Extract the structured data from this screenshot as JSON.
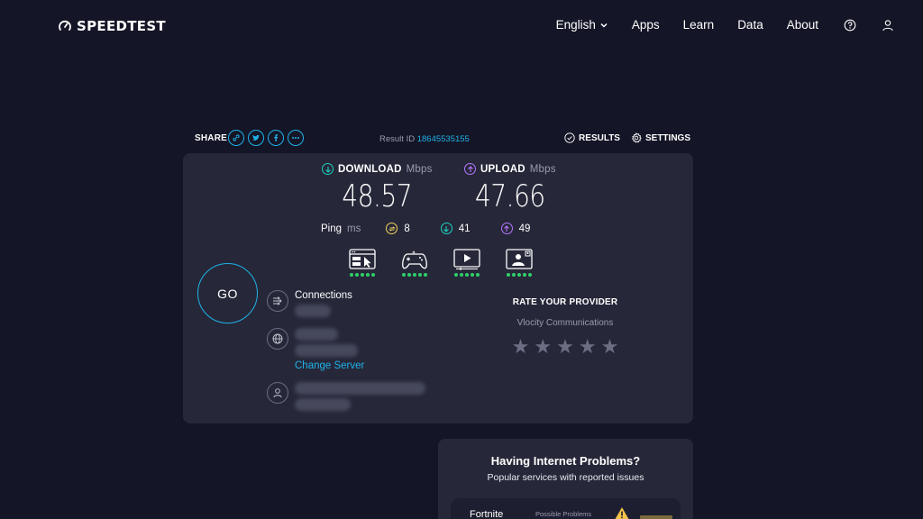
{
  "header": {
    "logo_text": "SPEEDTEST",
    "nav": {
      "language": "English",
      "apps": "Apps",
      "learn": "Learn",
      "data": "Data",
      "about": "About"
    },
    "icons": [
      "help-icon",
      "user-icon"
    ]
  },
  "share": {
    "label": "SHARE",
    "icons": [
      "link-icon",
      "twitter-icon",
      "facebook-icon",
      "more-icon"
    ],
    "result_id_label": "Result ID",
    "result_id": "18645535155",
    "results_label": "RESULTS",
    "settings_label": "SETTINGS"
  },
  "download": {
    "label": "DOWNLOAD",
    "unit": "Mbps",
    "value": "48.57",
    "color": "#1fd1c1"
  },
  "upload": {
    "label": "UPLOAD",
    "unit": "Mbps",
    "value": "47.66",
    "color": "#b676ff"
  },
  "ping": {
    "label": "Ping",
    "unit": "ms",
    "idle": "8",
    "download": "41",
    "upload": "49",
    "idle_color": "#f3d35c"
  },
  "quality": [
    {
      "name": "web-browsing",
      "rating": 5
    },
    {
      "name": "gaming",
      "rating": 5
    },
    {
      "name": "video-streaming",
      "rating": 5
    },
    {
      "name": "video-chat",
      "rating": 5
    }
  ],
  "go_label": "GO",
  "connections": {
    "label": "Connections"
  },
  "change_server": "Change Server",
  "rate": {
    "title": "RATE YOUR PROVIDER",
    "provider": "Vlocity Communications",
    "stars": 5
  },
  "problems": {
    "title": "Having Internet Problems?",
    "subtitle": "Popular services with reported issues",
    "services": [
      {
        "name": "Fortnite",
        "status": "Possible Problems"
      }
    ]
  },
  "colors": {
    "accent": "#1fb2e8",
    "background": "#141526",
    "panel": "#262839",
    "quality_dot": "#2fd06a"
  }
}
